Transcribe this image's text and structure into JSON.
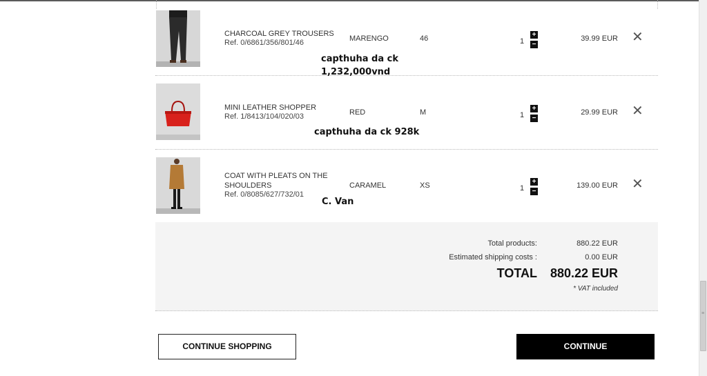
{
  "cart": {
    "items": [
      {
        "name": "CHARCOAL GREY TROUSERS",
        "ref": "Ref. 0/6861/356/801/46",
        "color": "MARENGO",
        "size": "46",
        "quantity": "1",
        "price": "39.99 EUR"
      },
      {
        "name": "MINI LEATHER SHOPPER",
        "ref": "Ref. 1/8413/104/020/03",
        "color": "RED",
        "size": "M",
        "quantity": "1",
        "price": "29.99 EUR"
      },
      {
        "name": "COAT WITH PLEATS ON THE SHOULDERS",
        "ref": "Ref. 0/8085/627/732/01",
        "color": "CARAMEL",
        "size": "XS",
        "quantity": "1",
        "price": "139.00 EUR"
      }
    ],
    "qty_plus_icon": "plus-icon",
    "qty_minus_icon": "minus-icon",
    "remove_icon": "close-icon"
  },
  "annotations": {
    "note1_line1": "capthuha da ck",
    "note1_line2": "1,232,000vnd",
    "note2": "capthuha da ck 928k",
    "note3": "C. Van"
  },
  "summary": {
    "total_products_label": "Total products:",
    "total_products_value": "880.22 EUR",
    "shipping_label": "Estimated shipping costs :",
    "shipping_value": "0.00 EUR",
    "total_label": "TOTAL",
    "total_value": "880.22 EUR",
    "vat_note": "* VAT included"
  },
  "buttons": {
    "continue_shopping": "CONTINUE SHOPPING",
    "continue": "CONTINUE"
  },
  "colors": {
    "primary_button_bg": "#000000",
    "summary_bg": "#f4f4f4",
    "bag_red": "#d8211c",
    "coat_caramel": "#b47a36"
  }
}
